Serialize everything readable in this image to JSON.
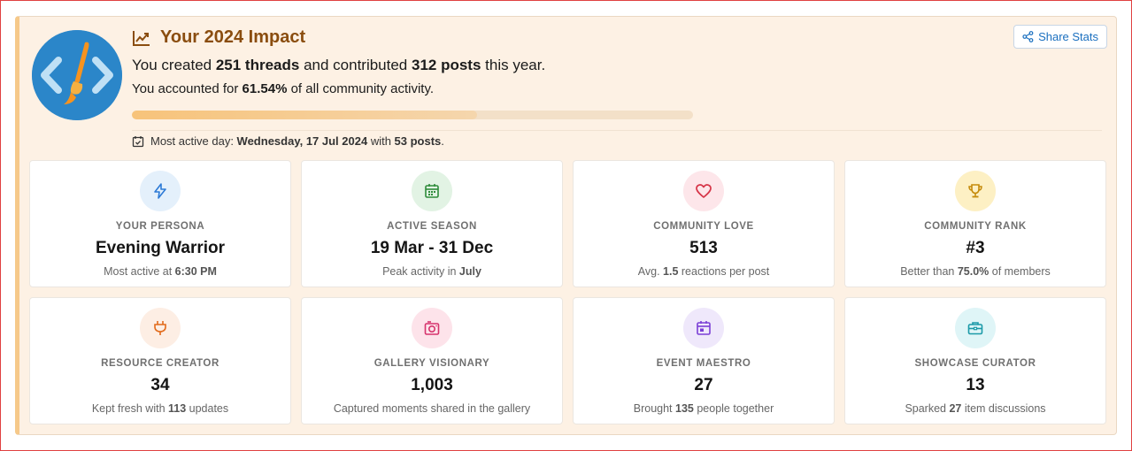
{
  "header": {
    "title": "Your 2024 Impact",
    "line1": {
      "pre": "You created ",
      "threads": "251 threads",
      "mid": " and contributed ",
      "posts": "312 posts",
      "post": " this year."
    },
    "line2": {
      "pre": "You accounted for ",
      "pct": "61.54%",
      "post": " of all community activity."
    },
    "progress_fraction": 0.6154,
    "most_active": {
      "label": "Most active day: ",
      "date": "Wednesday, 17 Jul 2024",
      "mid": " with ",
      "posts": "53 posts",
      "end": "."
    },
    "share_label": "Share Stats"
  },
  "colors": {
    "accent": "#8a4d0f",
    "card_bg": "#fdf1e4",
    "avatar_bg": "#2b86c9",
    "share_text": "#1a6fbf"
  },
  "stats": [
    {
      "icon": "lightning-icon",
      "icon_bg": "#e4f0fb",
      "icon_color": "#2d7ad6",
      "label": "Your Persona",
      "value": "Evening Warrior",
      "sub_pre": "Most active at ",
      "sub_bold": "6:30 PM",
      "sub_post": ""
    },
    {
      "icon": "calendar-grid-icon",
      "icon_bg": "#e2f3e4",
      "icon_color": "#2e8b3a",
      "label": "Active Season",
      "value": "19 Mar - 31 Dec",
      "sub_pre": "Peak activity in ",
      "sub_bold": "July",
      "sub_post": ""
    },
    {
      "icon": "heart-icon",
      "icon_bg": "#fde6ea",
      "icon_color": "#d63548",
      "label": "Community Love",
      "value": "513",
      "sub_pre": "Avg. ",
      "sub_bold": "1.5",
      "sub_post": " reactions per post"
    },
    {
      "icon": "trophy-icon",
      "icon_bg": "#fdf0c4",
      "icon_color": "#c58a0a",
      "label": "Community Rank",
      "value": "#3",
      "sub_pre": "Better than ",
      "sub_bold": "75.0%",
      "sub_post": " of members"
    },
    {
      "icon": "plug-icon",
      "icon_bg": "#fdeee4",
      "icon_color": "#e26a1a",
      "label": "Resource Creator",
      "value": "34",
      "sub_pre": "Kept fresh with ",
      "sub_bold": "113",
      "sub_post": " updates"
    },
    {
      "icon": "camera-icon",
      "icon_bg": "#fde3ea",
      "icon_color": "#d6336c",
      "label": "Gallery Visionary",
      "value": "1,003",
      "sub_pre": "Captured moments shared in the gallery",
      "sub_bold": "",
      "sub_post": ""
    },
    {
      "icon": "event-calendar-icon",
      "icon_bg": "#efe8fb",
      "icon_color": "#7b3fd6",
      "label": "Event Maestro",
      "value": "27",
      "sub_pre": "Brought ",
      "sub_bold": "135",
      "sub_post": " people together"
    },
    {
      "icon": "briefcase-icon",
      "icon_bg": "#dff5f7",
      "icon_color": "#1c9aa8",
      "label": "Showcase Curator",
      "value": "13",
      "sub_pre": "Sparked ",
      "sub_bold": "27",
      "sub_post": " item discussions"
    }
  ]
}
